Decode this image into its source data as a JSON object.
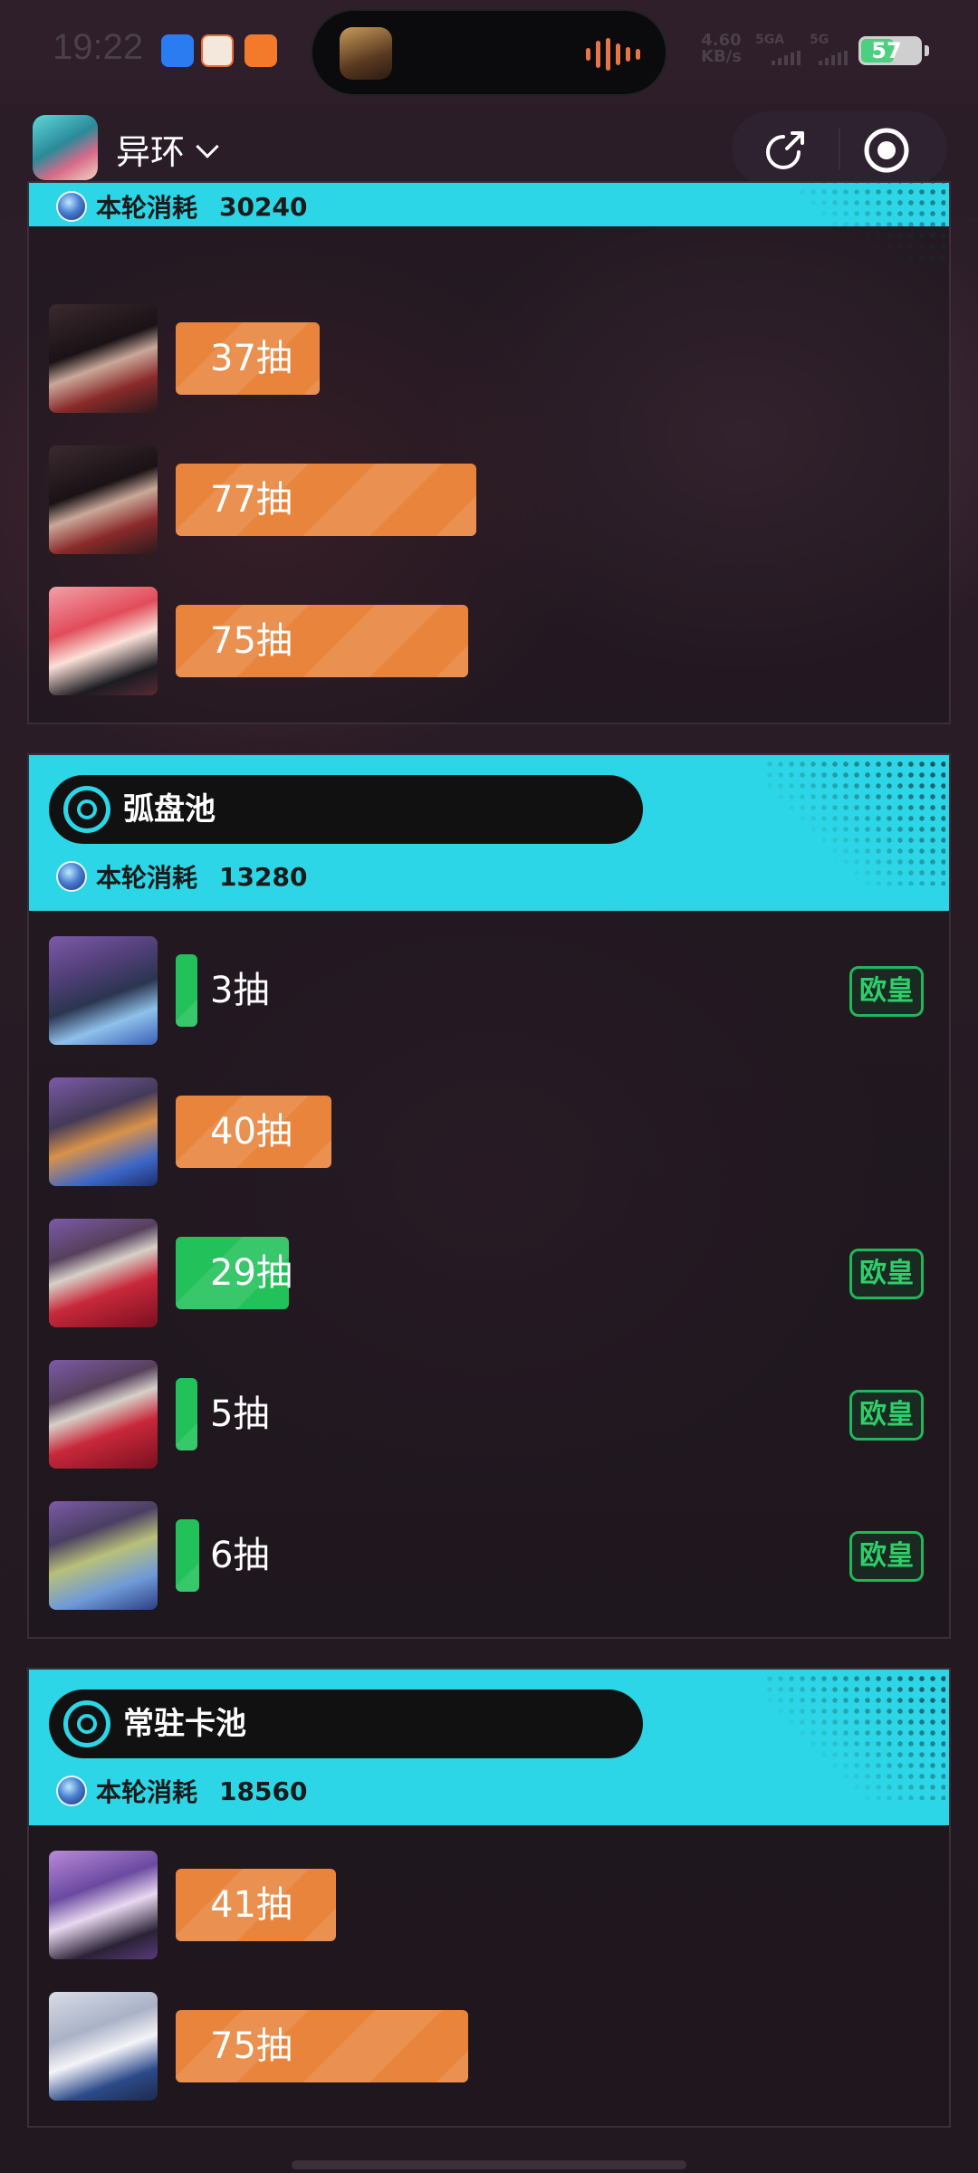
{
  "status_bar": {
    "time": "19:22",
    "net_speed_value": "4.60",
    "net_speed_unit": "KB/s",
    "signal1_label": "5GA",
    "signal2_label": "5G",
    "battery": "57"
  },
  "header": {
    "title": "异环"
  },
  "cost_label": "本轮消耗",
  "cards": [
    {
      "cost": "30240",
      "rows": [
        {
          "label": "37抽",
          "avatar": "character-avatar",
          "color": "orange",
          "pulls": 37
        },
        {
          "label": "77抽",
          "avatar": "character-avatar",
          "color": "orange",
          "pulls": 77
        },
        {
          "label": "75抽",
          "avatar": "character-avatar",
          "color": "orange",
          "pulls": 75
        }
      ]
    },
    {
      "name": "弧盘池",
      "cost": "13280",
      "rows": [
        {
          "label": "3抽",
          "avatar": "disc-avatar",
          "color": "green",
          "pulls": 3,
          "badge": "欧皇"
        },
        {
          "label": "40抽",
          "avatar": "disc-avatar",
          "color": "orange",
          "pulls": 40
        },
        {
          "label": "29抽",
          "avatar": "disc-avatar",
          "color": "green",
          "pulls": 29,
          "badge": "欧皇"
        },
        {
          "label": "5抽",
          "avatar": "disc-avatar",
          "color": "green",
          "pulls": 5,
          "badge": "欧皇"
        },
        {
          "label": "6抽",
          "avatar": "disc-avatar",
          "color": "green",
          "pulls": 6,
          "badge": "欧皇"
        }
      ]
    },
    {
      "name": "常驻卡池",
      "cost": "18560",
      "rows": [
        {
          "label": "41抽",
          "avatar": "character-avatar",
          "color": "orange",
          "pulls": 41
        },
        {
          "label": "75抽",
          "avatar": "character-avatar",
          "color": "orange",
          "pulls": 75
        }
      ]
    }
  ],
  "colors": {
    "accent_cyan": "#2cd6e6",
    "bar_orange": "#e8843c",
    "bar_green": "#22c15a",
    "badge_green": "#2fce6a"
  },
  "icons": [
    "share-icon",
    "target-icon",
    "chevron-down-icon",
    "gem-icon",
    "pool-ring-icon"
  ]
}
